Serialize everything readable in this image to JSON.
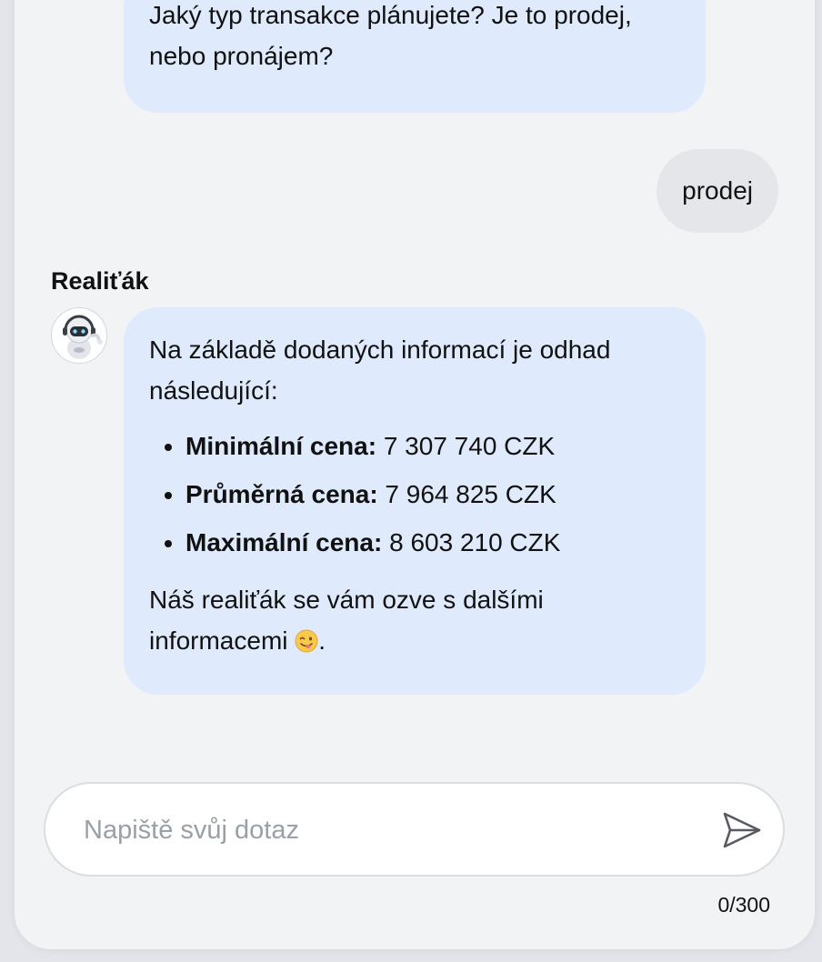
{
  "chat": {
    "messages": [
      {
        "role": "bot",
        "text": "Jaký typ transakce plánujete? Je to prodej, nebo pronájem?"
      },
      {
        "role": "user",
        "text": "prodej"
      },
      {
        "role": "bot",
        "sender": "Realiťák",
        "intro": "Na základě dodaných informací je odhad následující:",
        "items": [
          {
            "label": "Minimální cena:",
            "value": " 7 307 740 CZK"
          },
          {
            "label": "Průměrná cena:",
            "value": " 7 964 825 CZK"
          },
          {
            "label": "Maximální cena:",
            "value": " 8 603 210 CZK"
          }
        ],
        "outro": "Náš realiťák se vám ozve s dalšími informacemi",
        "outro_end": ".",
        "emoji": "wink-tongue-emoji"
      }
    ]
  },
  "composer": {
    "placeholder": "Napiště svůj dotaz",
    "value": "",
    "counter": "0/300",
    "send_icon": "send-icon"
  },
  "colors": {
    "bot_bubble": "#dfeafc",
    "user_bubble": "#e5e6e9",
    "panel": "#f2f3f5"
  }
}
